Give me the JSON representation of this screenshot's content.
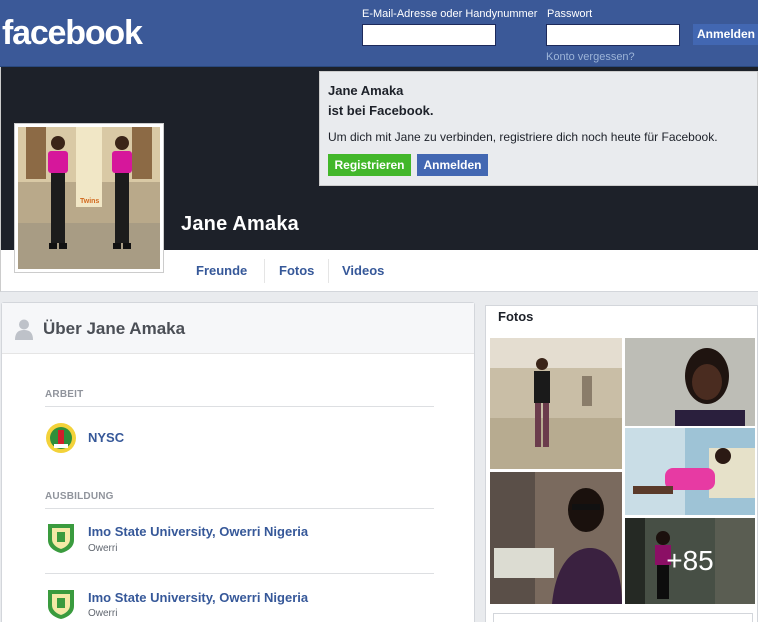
{
  "header": {
    "logo": "facebook",
    "email_label": "E-Mail-Adresse oder Handynummer",
    "password_label": "Passwort",
    "login_button": "Anmelden",
    "forgot_link": "Konto vergessen?"
  },
  "profile": {
    "name": "Jane Amaka"
  },
  "signup": {
    "name": "Jane Amaka",
    "is_on": "ist bei Facebook.",
    "text": "Um dich mit Jane zu verbinden, registriere dich noch heute für Facebook.",
    "register_button": "Registrieren",
    "login_button": "Anmelden"
  },
  "nav": {
    "items": [
      {
        "label": "Freunde"
      },
      {
        "label": "Fotos"
      },
      {
        "label": "Videos"
      }
    ]
  },
  "about": {
    "title": "Über Jane Amaka",
    "work_label": "Arbeit",
    "work": [
      {
        "title": "NYSC"
      }
    ],
    "education_label": "Ausbildung",
    "education": [
      {
        "title": "Imo State University, Owerri Nigeria",
        "sub": "Owerri"
      },
      {
        "title": "Imo State University, Owerri Nigeria",
        "sub": "Owerri"
      }
    ]
  },
  "photos": {
    "title": "Fotos",
    "more_count": "+85"
  },
  "profile_picture": {
    "caption": "Twins"
  },
  "colors": {
    "brand_blue": "#3b5998",
    "button_blue": "#4267b2",
    "button_green": "#42b72a",
    "link": "#365899",
    "cover": "#1d2129"
  }
}
